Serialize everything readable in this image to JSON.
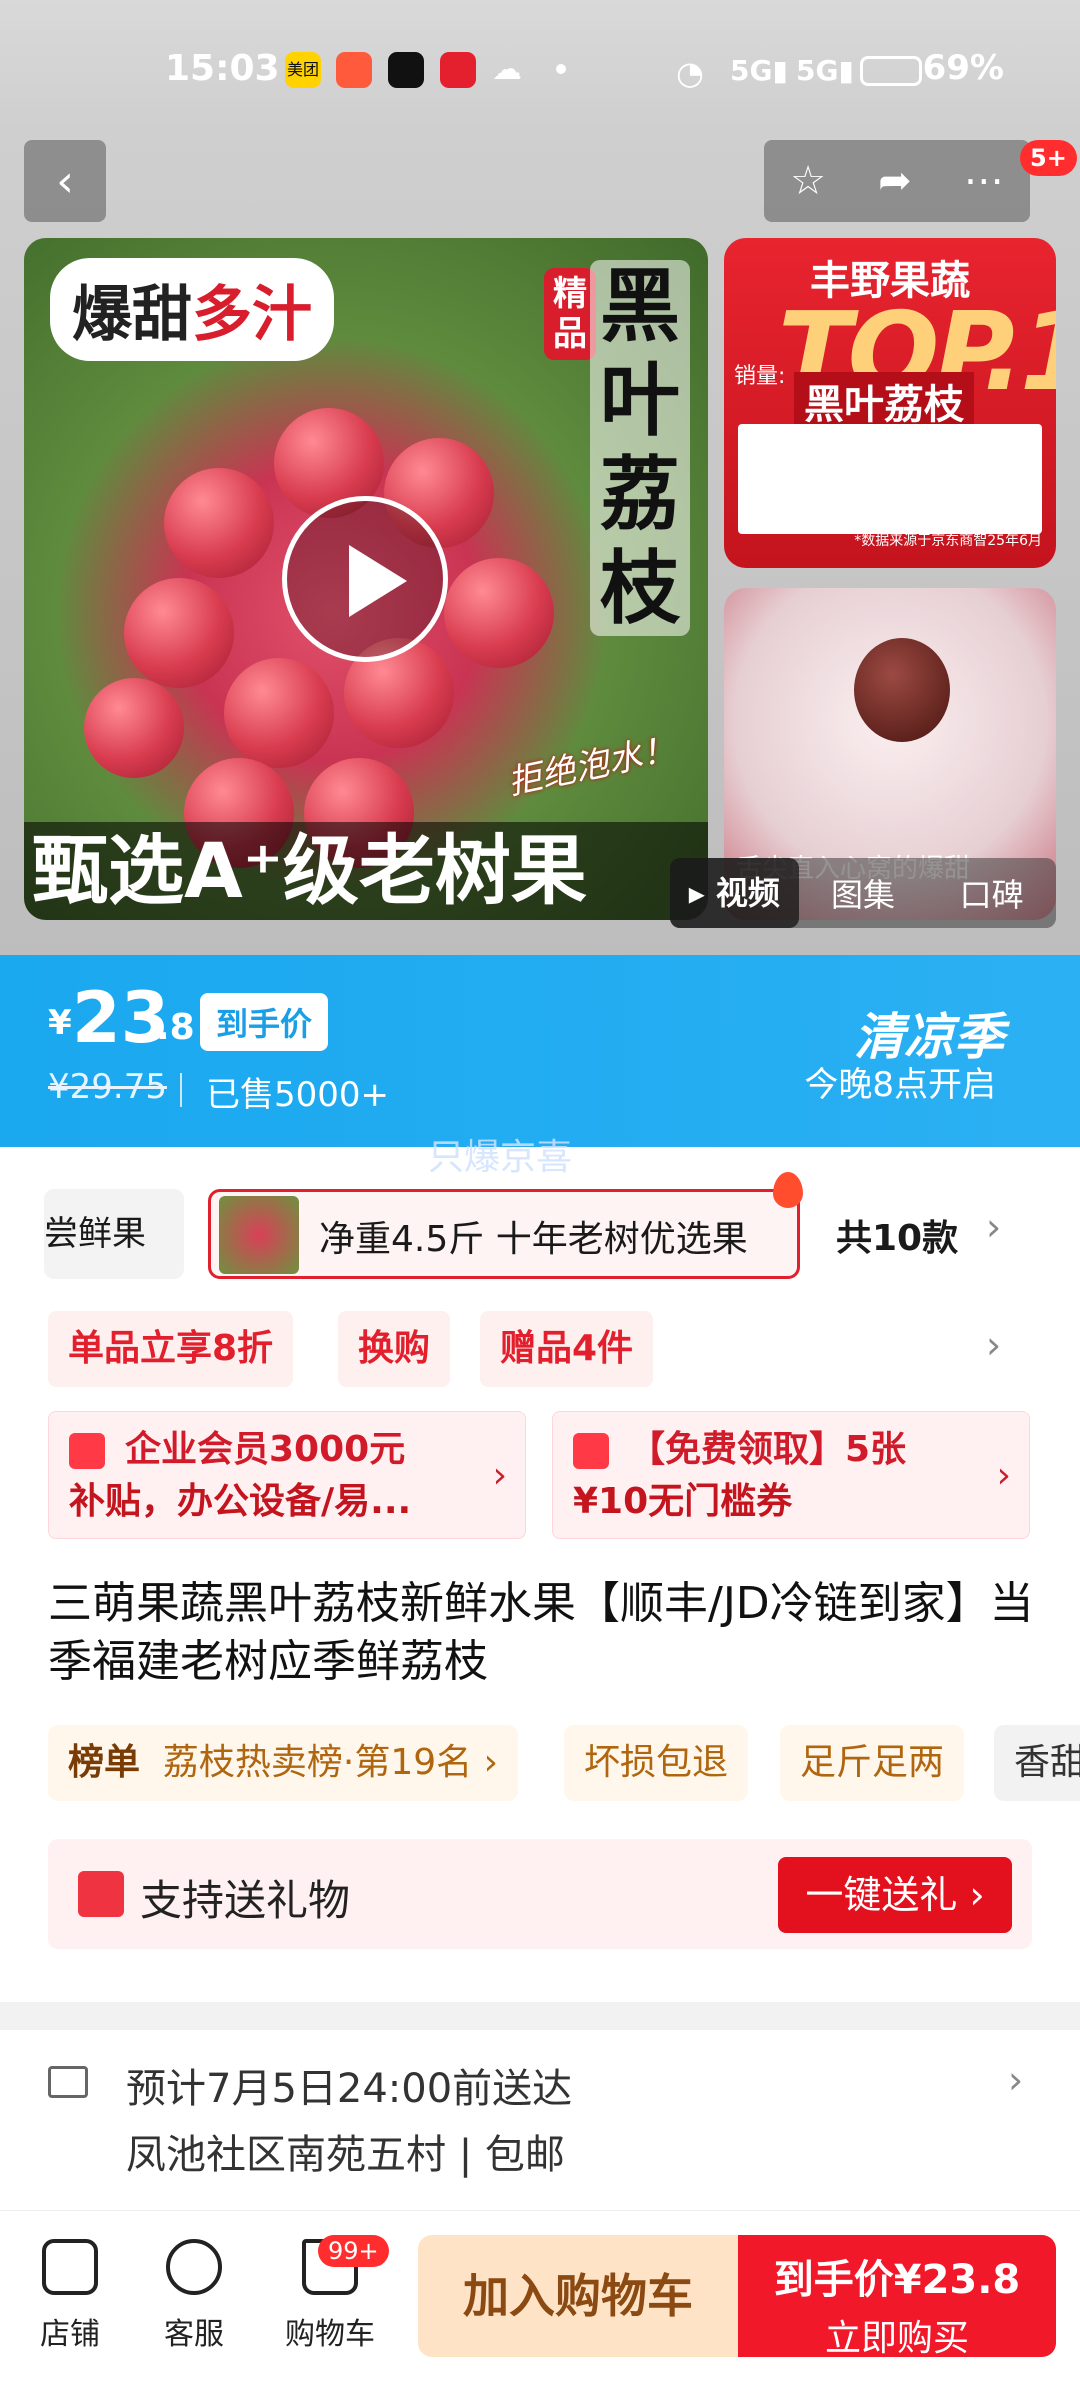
{
  "status": {
    "time": "15:03",
    "battery": "69%",
    "apps": [
      "美团",
      "",
      "",
      "",
      ""
    ]
  },
  "nav": {
    "back_icon": "chevron-left-icon",
    "star_icon": "star-icon",
    "share_icon": "share-icon",
    "more_icon": "more-icon",
    "badge": "5+"
  },
  "media": {
    "tag_left": "爆甜",
    "tag_right": "多汁",
    "vertical_title": "黑叶荔枝",
    "vertical_small": "精品",
    "script_text": "拒绝泡水！",
    "bottom_text": "甄选A⁺级老树果",
    "side1": {
      "top": "丰野果蔬",
      "big": "TOP.1",
      "sales": "销量:",
      "name": "黑叶荔枝",
      "footnote": "*数据来源于京东商智25年6月"
    },
    "side2": {
      "caption": "舌尖直入心窝的爆甜"
    },
    "tabs": [
      "视频",
      "图集",
      "口碑"
    ]
  },
  "price": {
    "yen": "¥",
    "big": "23",
    "dec": ".8",
    "tag": "到手价",
    "old": "¥29.75",
    "sold": "已售5000+",
    "season": "清凉季",
    "season_sub": "今晚8点开启",
    "watermark": "只爆京喜"
  },
  "variants": {
    "left": "尝鲜果",
    "selected": "净重4.5斤 十年老树优选果",
    "count": "共10款"
  },
  "promos": [
    "单品立享8折",
    "换购",
    "赠品4件"
  ],
  "coupons": [
    {
      "line1": "企业会员3000元",
      "line2": "补贴，办公设备/易..."
    },
    {
      "line1": "【免费领取】5张",
      "line2": "¥10无门槛券"
    }
  ],
  "product_title": "三萌果蔬黑叶荔枝新鲜水果【顺丰/JD冷链到家】当季福建老树应季鲜荔枝",
  "chips": {
    "rank_label": "榜单",
    "rank_value": "荔枝热卖榜·第19名 ›",
    "c2": "坏损包退",
    "c3": "足斤足两",
    "c4": "香甜"
  },
  "gift": {
    "text": "支持送礼物",
    "button": "一键送礼 ›"
  },
  "delivery": {
    "line1": "预计7月5日24:00前送达",
    "line2": "凤池社区南苑五村 | 包邮"
  },
  "bottom": {
    "store": "店铺",
    "service": "客服",
    "cart": "购物车",
    "cart_badge": "99+",
    "add_cart": "加入购物车",
    "buy_top": "到手价¥23.8",
    "buy_bottom": "立即购买"
  }
}
